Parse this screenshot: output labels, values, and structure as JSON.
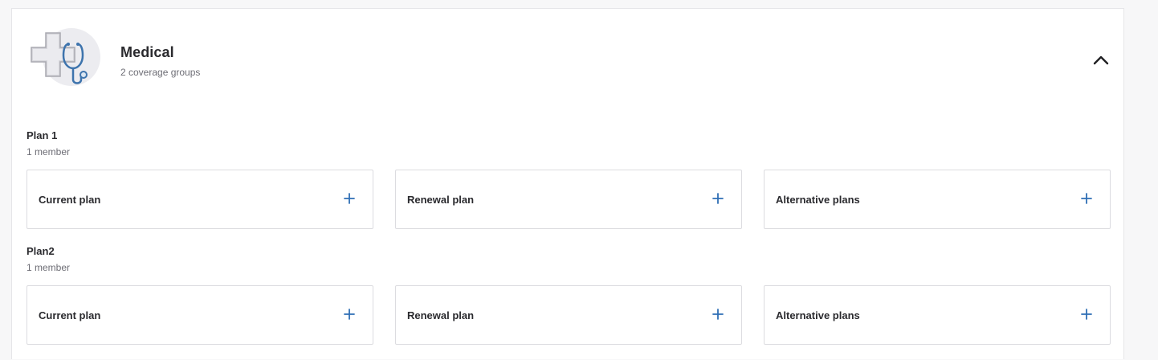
{
  "section": {
    "title": "Medical",
    "subtitle": "2 coverage groups",
    "icon": "medical-cross-stethoscope-icon",
    "collapse_icon": "chevron-up-icon"
  },
  "groups": [
    {
      "name": "Plan 1",
      "members": "1 member",
      "plans": [
        {
          "label": "Current plan",
          "icon": "plus-icon"
        },
        {
          "label": "Renewal plan",
          "icon": "plus-icon"
        },
        {
          "label": "Alternative plans",
          "icon": "plus-icon"
        }
      ]
    },
    {
      "name": "Plan2",
      "members": "1 member",
      "plans": [
        {
          "label": "Current plan",
          "icon": "plus-icon"
        },
        {
          "label": "Renewal plan",
          "icon": "plus-icon"
        },
        {
          "label": "Alternative plans",
          "icon": "plus-icon"
        }
      ]
    }
  ],
  "colors": {
    "accent": "#2f6fb5",
    "border": "#dcdce0",
    "text_primary": "#2a2a2e",
    "text_secondary": "#6d6d75"
  }
}
